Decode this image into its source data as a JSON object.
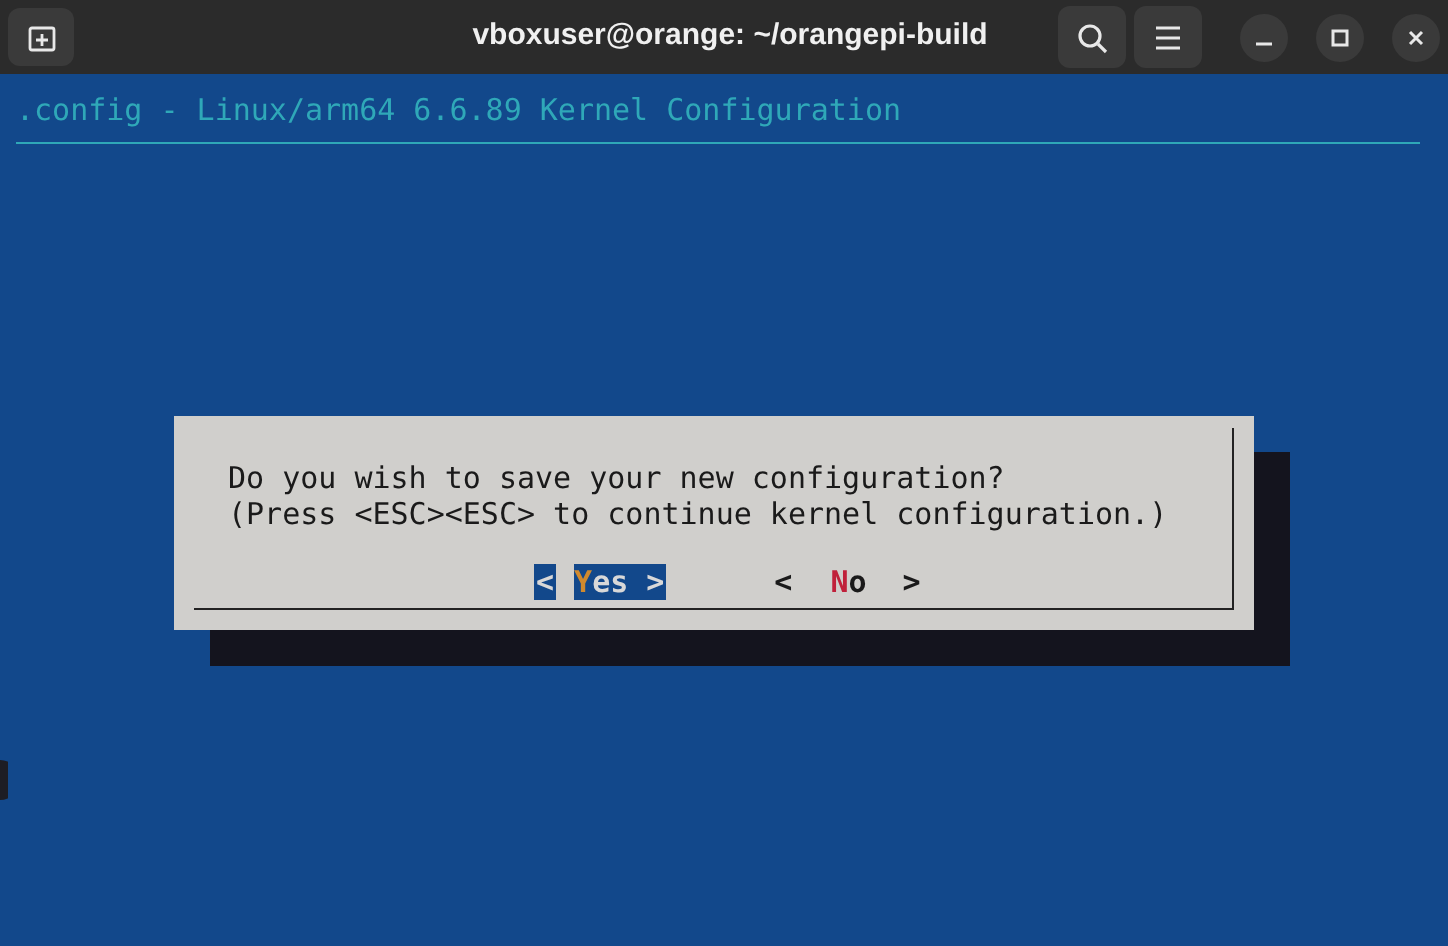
{
  "window": {
    "title": "vboxuser@orange: ~/orangepi-build"
  },
  "terminal": {
    "header": ".config - Linux/arm64 6.6.89 Kernel Configuration"
  },
  "dialog": {
    "lines": [
      "Do you wish to save your new configuration?",
      "(Press <ESC><ESC> to continue kernel configuration.)"
    ],
    "buttons": [
      {
        "open": "<",
        "label": "Yes",
        "close": ">",
        "selected": true
      },
      {
        "open": "<",
        "label": "No",
        "close": ">",
        "selected": false
      }
    ]
  }
}
